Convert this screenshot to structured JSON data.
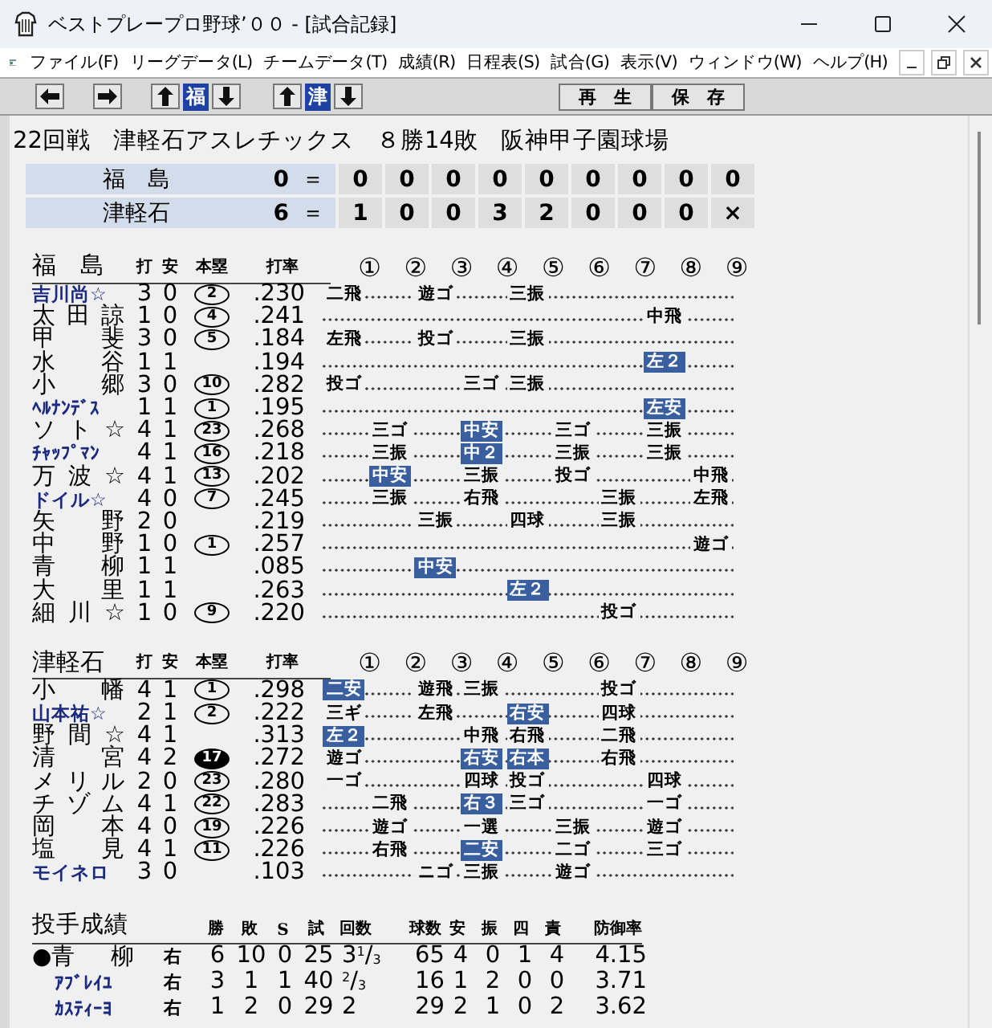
{
  "window": {
    "title": "ベストプレープロ野球’００ - [試合記録]"
  },
  "menu": [
    "ファイル(F)",
    "リーグデータ(L)",
    "チームデータ(T)",
    "成績(R)",
    "日程表(S)",
    "試合(G)",
    "表示(V)",
    "ウィンドウ(W)",
    "ヘルプ(H)"
  ],
  "toolbar": {
    "away_team": "福",
    "home_team": "津",
    "buttons": [
      "再　生",
      "保　存"
    ]
  },
  "game": {
    "round": "22回戦",
    "team": "津軽石アスレチックス",
    "record": "８勝14敗",
    "stadium": "阪神甲子園球場"
  },
  "scoreboard": [
    {
      "team": "福　島",
      "runs": "0",
      "equals": "＝",
      "innings": [
        "0",
        "0",
        "0",
        "0",
        "0",
        "0",
        "0",
        "0",
        "0"
      ]
    },
    {
      "team": "津軽石",
      "runs": "6",
      "equals": "＝",
      "innings": [
        "1",
        "0",
        "0",
        "3",
        "2",
        "0",
        "0",
        "0",
        "×"
      ]
    }
  ],
  "batting": [
    {
      "team": "福　島",
      "columns": [
        "打",
        "安",
        "本塁",
        "打率"
      ],
      "innings": [
        "①",
        "②",
        "③",
        "④",
        "⑤",
        "⑥",
        "⑦",
        "⑧",
        "⑨"
      ],
      "batters": [
        {
          "name": "吉川尚☆",
          "color": "#1c2a80",
          "ab": "3",
          "h": "0",
          "hr": "2",
          "hr_filled": false,
          "avg": ".230",
          "results": [
            {
              "kind": "play",
              "text": "二飛",
              "hit": false
            },
            {
              "kind": "blank"
            },
            {
              "kind": "play",
              "text": "遊ゴ",
              "hit": false
            },
            {
              "kind": "blank"
            },
            {
              "kind": "play",
              "text": "三振",
              "hit": false
            },
            {
              "kind": "blank"
            },
            {
              "kind": "blank"
            },
            {
              "kind": "blank"
            },
            {
              "kind": "blank"
            }
          ]
        },
        {
          "name": "太田諒",
          "color": "#000000",
          "ab": "1",
          "h": "0",
          "hr": "4",
          "hr_filled": false,
          "avg": ".241",
          "results": [
            {
              "kind": "blank"
            },
            {
              "kind": "blank"
            },
            {
              "kind": "blank"
            },
            {
              "kind": "blank"
            },
            {
              "kind": "blank"
            },
            {
              "kind": "blank"
            },
            {
              "kind": "blank"
            },
            {
              "kind": "play",
              "text": "中飛",
              "hit": false
            },
            {
              "kind": "blank"
            }
          ]
        },
        {
          "name": "甲　斐",
          "color": "#000000",
          "ab": "3",
          "h": "0",
          "hr": "5",
          "hr_filled": false,
          "avg": ".184",
          "results": [
            {
              "kind": "play",
              "text": "左飛",
              "hit": false
            },
            {
              "kind": "blank"
            },
            {
              "kind": "play",
              "text": "投ゴ",
              "hit": false
            },
            {
              "kind": "blank"
            },
            {
              "kind": "play",
              "text": "三振",
              "hit": false
            },
            {
              "kind": "blank"
            },
            {
              "kind": "blank"
            },
            {
              "kind": "blank"
            },
            {
              "kind": "blank"
            }
          ]
        },
        {
          "name": "水　谷",
          "color": "#000000",
          "ab": "1",
          "h": "1",
          "avg": ".194",
          "results": [
            {
              "kind": "blank"
            },
            {
              "kind": "blank"
            },
            {
              "kind": "blank"
            },
            {
              "kind": "blank"
            },
            {
              "kind": "blank"
            },
            {
              "kind": "blank"
            },
            {
              "kind": "blank"
            },
            {
              "kind": "play",
              "text": "左２",
              "hit": true
            },
            {
              "kind": "blank"
            }
          ]
        },
        {
          "name": "小　郷",
          "color": "#000000",
          "ab": "3",
          "h": "0",
          "hr": "10",
          "hr_filled": false,
          "avg": ".282",
          "results": [
            {
              "kind": "play",
              "text": "投ゴ",
              "hit": false
            },
            {
              "kind": "blank"
            },
            {
              "kind": "blank"
            },
            {
              "kind": "play",
              "text": "三ゴ",
              "hit": false
            },
            {
              "kind": "play",
              "text": "三振",
              "hit": false
            },
            {
              "kind": "blank"
            },
            {
              "kind": "blank"
            },
            {
              "kind": "blank"
            },
            {
              "kind": "blank"
            }
          ]
        },
        {
          "name": "ﾍﾙﾅﾝﾃﾞｽ",
          "color": "#1c2a80",
          "ab": "1",
          "h": "1",
          "hr": "1",
          "hr_filled": false,
          "avg": ".195",
          "results": [
            {
              "kind": "blank"
            },
            {
              "kind": "blank"
            },
            {
              "kind": "blank"
            },
            {
              "kind": "blank"
            },
            {
              "kind": "blank"
            },
            {
              "kind": "blank"
            },
            {
              "kind": "blank"
            },
            {
              "kind": "play",
              "text": "左安",
              "hit": true
            },
            {
              "kind": "blank"
            }
          ]
        },
        {
          "name": "ソト☆",
          "color": "#000000",
          "ab": "4",
          "h": "1",
          "hr": "23",
          "hr_filled": false,
          "avg": ".268",
          "results": [
            {
              "kind": "blank"
            },
            {
              "kind": "play",
              "text": "三ゴ",
              "hit": false
            },
            {
              "kind": "blank"
            },
            {
              "kind": "play",
              "text": "中安",
              "hit": true
            },
            {
              "kind": "blank"
            },
            {
              "kind": "play",
              "text": "三ゴ",
              "hit": false
            },
            {
              "kind": "blank"
            },
            {
              "kind": "play",
              "text": "三振",
              "hit": false
            },
            {
              "kind": "blank"
            }
          ]
        },
        {
          "name": "ﾁｬｯﾌﾟﾏﾝ",
          "color": "#1c2a80",
          "ab": "4",
          "h": "1",
          "hr": "16",
          "hr_filled": false,
          "avg": ".218",
          "results": [
            {
              "kind": "blank"
            },
            {
              "kind": "play",
              "text": "三振",
              "hit": false
            },
            {
              "kind": "blank"
            },
            {
              "kind": "play",
              "text": "中２",
              "hit": true
            },
            {
              "kind": "blank"
            },
            {
              "kind": "play",
              "text": "三振",
              "hit": false
            },
            {
              "kind": "blank"
            },
            {
              "kind": "play",
              "text": "三振",
              "hit": false
            },
            {
              "kind": "blank"
            }
          ]
        },
        {
          "name": "万波☆",
          "color": "#000000",
          "ab": "4",
          "h": "1",
          "hr": "13",
          "hr_filled": false,
          "avg": ".202",
          "results": [
            {
              "kind": "blank"
            },
            {
              "kind": "play",
              "text": "中安",
              "hit": true
            },
            {
              "kind": "blank"
            },
            {
              "kind": "play",
              "text": "三振",
              "hit": false
            },
            {
              "kind": "blank"
            },
            {
              "kind": "play",
              "text": "投ゴ",
              "hit": false
            },
            {
              "kind": "blank"
            },
            {
              "kind": "blank"
            },
            {
              "kind": "play",
              "text": "中飛",
              "hit": false
            }
          ]
        },
        {
          "name": "ドイル☆",
          "color": "#1c2a80",
          "ab": "4",
          "h": "0",
          "hr": "7",
          "hr_filled": false,
          "avg": ".245",
          "results": [
            {
              "kind": "blank"
            },
            {
              "kind": "play",
              "text": "三振",
              "hit": false
            },
            {
              "kind": "blank"
            },
            {
              "kind": "play",
              "text": "右飛",
              "hit": false
            },
            {
              "kind": "blank"
            },
            {
              "kind": "blank"
            },
            {
              "kind": "play",
              "text": "三振",
              "hit": false
            },
            {
              "kind": "blank"
            },
            {
              "kind": "play",
              "text": "左飛",
              "hit": false
            }
          ]
        },
        {
          "name": "矢　野",
          "color": "#000000",
          "ab": "2",
          "h": "0",
          "avg": ".219",
          "results": [
            {
              "kind": "blank"
            },
            {
              "kind": "blank"
            },
            {
              "kind": "play",
              "text": "三振",
              "hit": false
            },
            {
              "kind": "blank"
            },
            {
              "kind": "play",
              "text": "四球",
              "hit": false
            },
            {
              "kind": "blank"
            },
            {
              "kind": "play",
              "text": "三振",
              "hit": false
            },
            {
              "kind": "blank"
            },
            {
              "kind": "blank"
            }
          ]
        },
        {
          "name": "中　野",
          "color": "#000000",
          "ab": "1",
          "h": "0",
          "hr": "1",
          "hr_filled": false,
          "avg": ".257",
          "results": [
            {
              "kind": "blank"
            },
            {
              "kind": "blank"
            },
            {
              "kind": "blank"
            },
            {
              "kind": "blank"
            },
            {
              "kind": "blank"
            },
            {
              "kind": "blank"
            },
            {
              "kind": "blank"
            },
            {
              "kind": "blank"
            },
            {
              "kind": "play",
              "text": "遊ゴ",
              "hit": false
            }
          ]
        },
        {
          "name": "青　柳",
          "color": "#000000",
          "ab": "1",
          "h": "1",
          "avg": ".085",
          "results": [
            {
              "kind": "blank"
            },
            {
              "kind": "blank"
            },
            {
              "kind": "play",
              "text": "中安",
              "hit": true
            },
            {
              "kind": "blank"
            },
            {
              "kind": "blank"
            },
            {
              "kind": "blank"
            },
            {
              "kind": "blank"
            },
            {
              "kind": "blank"
            },
            {
              "kind": "blank"
            }
          ]
        },
        {
          "name": "大　里",
          "color": "#000000",
          "ab": "1",
          "h": "1",
          "avg": ".263",
          "results": [
            {
              "kind": "blank"
            },
            {
              "kind": "blank"
            },
            {
              "kind": "blank"
            },
            {
              "kind": "blank"
            },
            {
              "kind": "play",
              "text": "左２",
              "hit": true
            },
            {
              "kind": "blank"
            },
            {
              "kind": "blank"
            },
            {
              "kind": "blank"
            },
            {
              "kind": "blank"
            }
          ]
        },
        {
          "name": "細川☆",
          "color": "#000000",
          "ab": "1",
          "h": "0",
          "hr": "9",
          "hr_filled": false,
          "avg": ".220",
          "results": [
            {
              "kind": "blank"
            },
            {
              "kind": "blank"
            },
            {
              "kind": "blank"
            },
            {
              "kind": "blank"
            },
            {
              "kind": "blank"
            },
            {
              "kind": "blank"
            },
            {
              "kind": "play",
              "text": "投ゴ",
              "hit": false
            },
            {
              "kind": "blank"
            },
            {
              "kind": "blank"
            }
          ]
        }
      ]
    },
    {
      "team": "津軽石",
      "columns": [
        "打",
        "安",
        "本塁",
        "打率"
      ],
      "innings": [
        "①",
        "②",
        "③",
        "④",
        "⑤",
        "⑥",
        "⑦",
        "⑧",
        "⑨"
      ],
      "batters": [
        {
          "name": "小　幡",
          "color": "#000000",
          "ab": "4",
          "h": "1",
          "hr": "1",
          "hr_filled": false,
          "avg": ".298",
          "results": [
            {
              "kind": "play",
              "text": "二安",
              "hit": true
            },
            {
              "kind": "blank"
            },
            {
              "kind": "play",
              "text": "遊飛",
              "hit": false
            },
            {
              "kind": "play",
              "text": "三振",
              "hit": false
            },
            {
              "kind": "blank"
            },
            {
              "kind": "blank"
            },
            {
              "kind": "play",
              "text": "投ゴ",
              "hit": false
            },
            {
              "kind": "blank"
            },
            {
              "kind": "blank"
            }
          ]
        },
        {
          "name": "山本祐☆",
          "color": "#1c2a80",
          "ab": "2",
          "h": "1",
          "hr": "2",
          "hr_filled": false,
          "avg": ".222",
          "results": [
            {
              "kind": "play",
              "text": "三ギ",
              "hit": false
            },
            {
              "kind": "blank"
            },
            {
              "kind": "play",
              "text": "左飛",
              "hit": false
            },
            {
              "kind": "blank"
            },
            {
              "kind": "play",
              "text": "右安",
              "hit": true
            },
            {
              "kind": "blank"
            },
            {
              "kind": "play",
              "text": "四球",
              "hit": false
            },
            {
              "kind": "blank"
            },
            {
              "kind": "blank"
            }
          ]
        },
        {
          "name": "野間☆",
          "color": "#000000",
          "ab": "4",
          "h": "1",
          "avg": ".313",
          "results": [
            {
              "kind": "play",
              "text": "左２",
              "hit": true
            },
            {
              "kind": "blank"
            },
            {
              "kind": "blank"
            },
            {
              "kind": "play",
              "text": "中飛",
              "hit": false
            },
            {
              "kind": "play",
              "text": "右飛",
              "hit": false
            },
            {
              "kind": "blank"
            },
            {
              "kind": "play",
              "text": "二飛",
              "hit": false
            },
            {
              "kind": "blank"
            },
            {
              "kind": "blank"
            }
          ]
        },
        {
          "name": "清　宮",
          "color": "#000000",
          "ab": "4",
          "h": "2",
          "hr": "17",
          "hr_filled": true,
          "avg": ".272",
          "results": [
            {
              "kind": "play",
              "text": "遊ゴ",
              "hit": false
            },
            {
              "kind": "blank"
            },
            {
              "kind": "blank"
            },
            {
              "kind": "play",
              "text": "右安",
              "hit": true
            },
            {
              "kind": "play",
              "text": "右本",
              "hit": true
            },
            {
              "kind": "blank"
            },
            {
              "kind": "play",
              "text": "右飛",
              "hit": false
            },
            {
              "kind": "blank"
            },
            {
              "kind": "blank"
            }
          ]
        },
        {
          "name": "メリル",
          "color": "#000000",
          "ab": "2",
          "h": "0",
          "hr": "23",
          "hr_filled": false,
          "avg": ".280",
          "results": [
            {
              "kind": "play",
              "text": "一ゴ",
              "hit": false
            },
            {
              "kind": "blank"
            },
            {
              "kind": "blank"
            },
            {
              "kind": "play",
              "text": "四球",
              "hit": false
            },
            {
              "kind": "play",
              "text": "投ゴ",
              "hit": false
            },
            {
              "kind": "blank"
            },
            {
              "kind": "blank"
            },
            {
              "kind": "play",
              "text": "四球",
              "hit": false
            },
            {
              "kind": "blank"
            }
          ]
        },
        {
          "name": "チゾム",
          "color": "#000000",
          "ab": "4",
          "h": "1",
          "hr": "22",
          "hr_filled": false,
          "avg": ".283",
          "results": [
            {
              "kind": "blank"
            },
            {
              "kind": "play",
              "text": "二飛",
              "hit": false
            },
            {
              "kind": "blank"
            },
            {
              "kind": "play",
              "text": "右３",
              "hit": true
            },
            {
              "kind": "play",
              "text": "三ゴ",
              "hit": false
            },
            {
              "kind": "blank"
            },
            {
              "kind": "blank"
            },
            {
              "kind": "play",
              "text": "一ゴ",
              "hit": false
            },
            {
              "kind": "blank"
            }
          ]
        },
        {
          "name": "岡　本",
          "color": "#000000",
          "ab": "4",
          "h": "0",
          "hr": "19",
          "hr_filled": false,
          "avg": ".226",
          "results": [
            {
              "kind": "blank"
            },
            {
              "kind": "play",
              "text": "遊ゴ",
              "hit": false
            },
            {
              "kind": "blank"
            },
            {
              "kind": "play",
              "text": "一選",
              "hit": false
            },
            {
              "kind": "blank"
            },
            {
              "kind": "play",
              "text": "三振",
              "hit": false
            },
            {
              "kind": "blank"
            },
            {
              "kind": "play",
              "text": "遊ゴ",
              "hit": false
            },
            {
              "kind": "blank"
            }
          ]
        },
        {
          "name": "塩　見",
          "color": "#000000",
          "ab": "4",
          "h": "1",
          "hr": "11",
          "hr_filled": false,
          "avg": ".226",
          "results": [
            {
              "kind": "blank"
            },
            {
              "kind": "play",
              "text": "右飛",
              "hit": false
            },
            {
              "kind": "blank"
            },
            {
              "kind": "play",
              "text": "二安",
              "hit": true
            },
            {
              "kind": "blank"
            },
            {
              "kind": "play",
              "text": "二ゴ",
              "hit": false
            },
            {
              "kind": "blank"
            },
            {
              "kind": "play",
              "text": "三ゴ",
              "hit": false
            },
            {
              "kind": "blank"
            }
          ]
        },
        {
          "name": "モイネロ",
          "color": "#1c2a80",
          "ab": "3",
          "h": "0",
          "avg": ".103",
          "results": [
            {
              "kind": "blank"
            },
            {
              "kind": "blank"
            },
            {
              "kind": "play",
              "text": "ニゴ",
              "hit": false
            },
            {
              "kind": "play",
              "text": "三振",
              "hit": false
            },
            {
              "kind": "blank"
            },
            {
              "kind": "play",
              "text": "遊ゴ",
              "hit": false
            },
            {
              "kind": "blank"
            },
            {
              "kind": "blank"
            },
            {
              "kind": "blank"
            }
          ]
        }
      ]
    }
  ],
  "pitching": {
    "title": "投手成績",
    "columns": [
      "勝",
      "敗",
      "S",
      "試",
      "回数",
      "球数",
      "安",
      "振",
      "四",
      "責",
      "防御率"
    ],
    "pitchers": [
      {
        "mark": "●",
        "name": "青　柳",
        "color": "#000000",
        "hand": "右",
        "stats": [
          "6",
          "10",
          "0",
          "25",
          "3$^{1}$/$_{3}$",
          "65",
          "4",
          "0",
          "1",
          "4",
          "4.15"
        ]
      },
      {
        "name": "ｱﾌﾞﾚｲﾕ",
        "color": "#1c2a80",
        "hand": "右",
        "stats": [
          "3",
          "1",
          "1",
          "40",
          "$^{2}$/$_{3}$",
          "16",
          "1",
          "2",
          "0",
          "0",
          "3.71"
        ]
      },
      {
        "name": "ｶｽﾃｨｰﾖ",
        "color": "#1c2a80",
        "hand": "右",
        "stats": [
          "1",
          "2",
          "0",
          "29",
          "2",
          "29",
          "2",
          "1",
          "0",
          "2",
          "3.62"
        ]
      }
    ]
  }
}
